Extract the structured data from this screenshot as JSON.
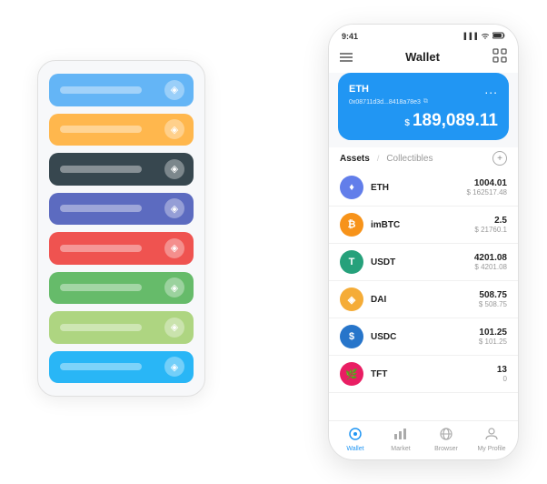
{
  "scene": {
    "leftPhone": {
      "cards": [
        {
          "color": "#64B5F6",
          "label": "card-blue-light"
        },
        {
          "color": "#FFB74D",
          "label": "card-orange"
        },
        {
          "color": "#37474F",
          "label": "card-dark"
        },
        {
          "color": "#5C6BC0",
          "label": "card-purple"
        },
        {
          "color": "#EF5350",
          "label": "card-red"
        },
        {
          "color": "#66BB6A",
          "label": "card-green"
        },
        {
          "color": "#AED581",
          "label": "card-light-green"
        },
        {
          "color": "#29B6F6",
          "label": "card-sky-blue"
        }
      ]
    },
    "rightPhone": {
      "statusBar": {
        "time": "9:41",
        "signal": "●●●",
        "wifi": "WiFi",
        "battery": "Battery"
      },
      "header": {
        "menuIcon": "☰",
        "title": "Wallet",
        "scanIcon": "⛶"
      },
      "walletCard": {
        "ethLabel": "ETH",
        "address": "0x08711d3d...8418a78e3",
        "copyIcon": "⧉",
        "moreIcon": "...",
        "currencySymbol": "$",
        "balance": "189,089.11"
      },
      "assetsSection": {
        "tabActive": "Assets",
        "separator": "/",
        "tabInactive": "Collectibles",
        "addIcon": "+"
      },
      "assets": [
        {
          "name": "ETH",
          "iconEmoji": "♦",
          "iconColor": "#627EEA",
          "amount": "1004.01",
          "usdValue": "$ 162517.48"
        },
        {
          "name": "imBTC",
          "iconEmoji": "₿",
          "iconColor": "#F7931A",
          "amount": "2.5",
          "usdValue": "$ 21760.1"
        },
        {
          "name": "USDT",
          "iconEmoji": "T",
          "iconColor": "#26A17B",
          "amount": "4201.08",
          "usdValue": "$ 4201.08"
        },
        {
          "name": "DAI",
          "iconEmoji": "◈",
          "iconColor": "#F5AC37",
          "amount": "508.75",
          "usdValue": "$ 508.75"
        },
        {
          "name": "USDC",
          "iconEmoji": "$",
          "iconColor": "#2775CA",
          "amount": "101.25",
          "usdValue": "$ 101.25"
        },
        {
          "name": "TFT",
          "iconEmoji": "🌿",
          "iconColor": "#E91E63",
          "amount": "13",
          "usdValue": "0"
        }
      ],
      "bottomNav": [
        {
          "label": "Wallet",
          "icon": "⊙",
          "active": true
        },
        {
          "label": "Market",
          "icon": "📊",
          "active": false
        },
        {
          "label": "Browser",
          "icon": "👤",
          "active": false
        },
        {
          "label": "My Profile",
          "icon": "👤",
          "active": false
        }
      ]
    }
  }
}
